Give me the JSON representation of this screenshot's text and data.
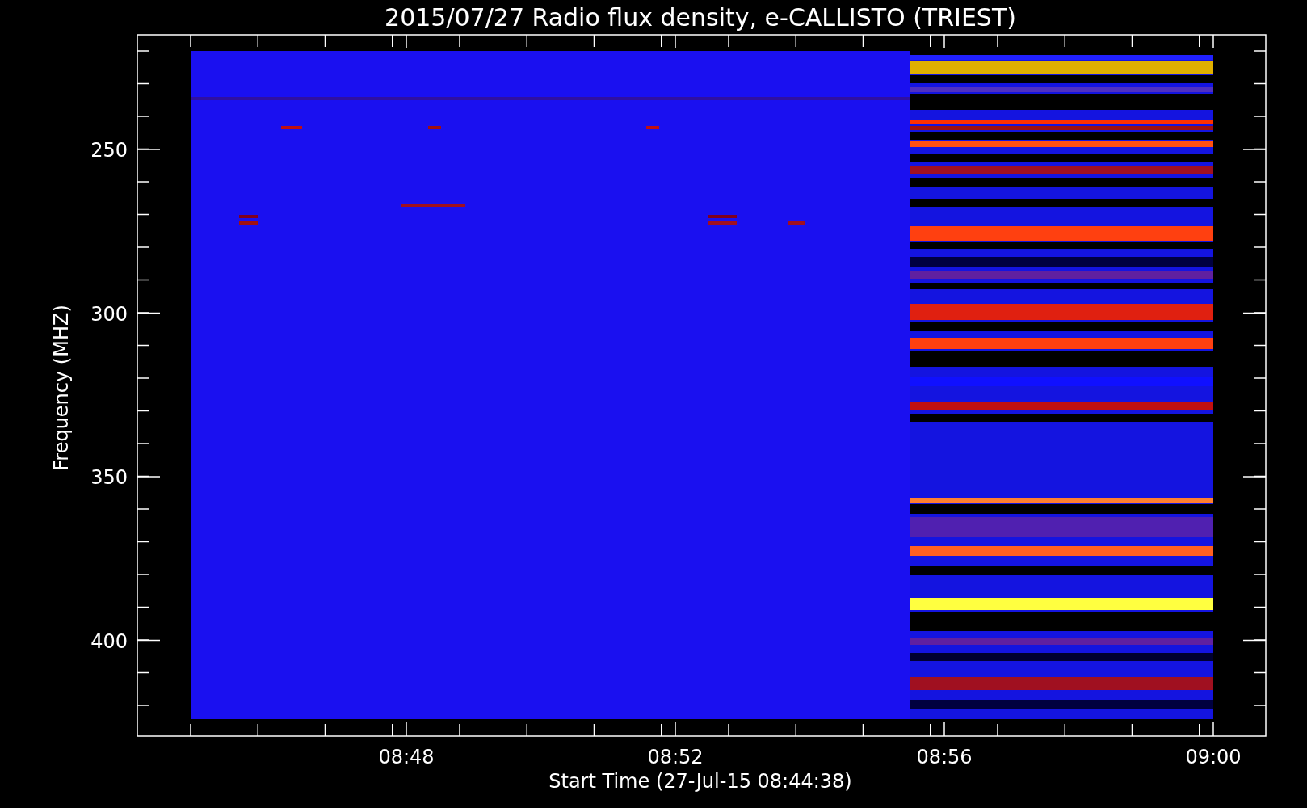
{
  "title": "2015/07/27  Radio flux density, e-CALLISTO (TRIEST)",
  "y_axis": {
    "label": "Frequency (MHZ)",
    "ticks": [
      "250",
      "300",
      "350",
      "400"
    ]
  },
  "x_axis": {
    "label": "Start Time (27-Jul-15 08:44:38)",
    "ticks": [
      "08:48",
      "08:52",
      "08:56",
      "09:00"
    ]
  }
}
